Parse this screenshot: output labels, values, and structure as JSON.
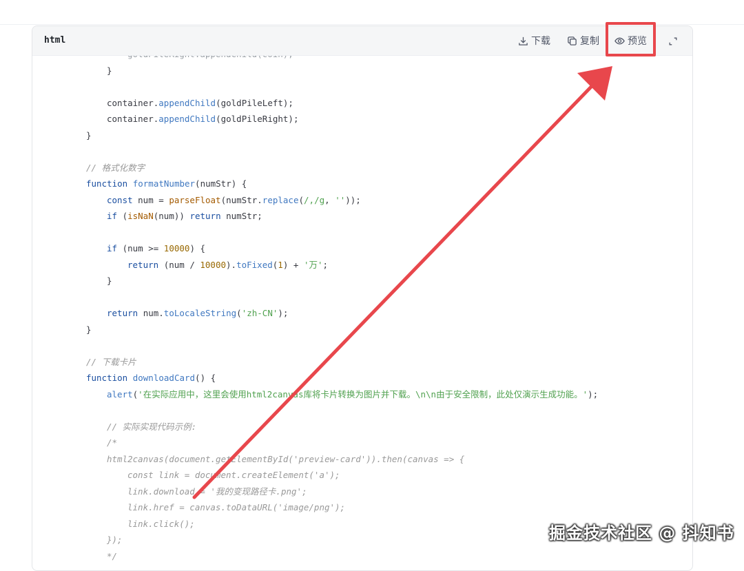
{
  "code_block": {
    "language": "html",
    "toolbar": {
      "download_label": "下载",
      "copy_label": "复制",
      "preview_label": "预览",
      "icons": [
        "download-icon",
        "copy-icon",
        "eye-icon",
        "expand-icon"
      ]
    }
  },
  "code_lines": [
    {
      "indent": 2,
      "parts": [
        [
          "cut",
          "goldPileRight.appendChild(coin);"
        ]
      ]
    },
    {
      "indent": 1,
      "parts": [
        [
          "",
          "}"
        ]
      ]
    },
    {
      "indent": 0,
      "parts": []
    },
    {
      "indent": 1,
      "parts": [
        [
          "",
          "container."
        ],
        [
          "fn",
          "appendChild"
        ],
        [
          "",
          "(goldPileLeft);"
        ]
      ]
    },
    {
      "indent": 1,
      "parts": [
        [
          "",
          "container."
        ],
        [
          "fn",
          "appendChild"
        ],
        [
          "",
          "(goldPileRight);"
        ]
      ]
    },
    {
      "indent": 0,
      "parts": [
        [
          "",
          "}"
        ]
      ]
    },
    {
      "indent": 0,
      "parts": []
    },
    {
      "indent": 0,
      "parts": [
        [
          "cm",
          "// 格式化数字"
        ]
      ]
    },
    {
      "indent": 0,
      "parts": [
        [
          "kw",
          "function "
        ],
        [
          "fn",
          "formatNumber"
        ],
        [
          "",
          "(numStr) {"
        ]
      ]
    },
    {
      "indent": 1,
      "parts": [
        [
          "kw",
          "const "
        ],
        [
          "",
          "num = "
        ],
        [
          "bi",
          "parseFloat"
        ],
        [
          "",
          "(numStr."
        ],
        [
          "fn",
          "replace"
        ],
        [
          "",
          "("
        ],
        [
          "str",
          "/,/g"
        ],
        [
          "",
          ", "
        ],
        [
          "str",
          "''"
        ],
        [
          "",
          "));"
        ]
      ]
    },
    {
      "indent": 1,
      "parts": [
        [
          "kw",
          "if "
        ],
        [
          "",
          "("
        ],
        [
          "bi",
          "isNaN"
        ],
        [
          "",
          "(num)) "
        ],
        [
          "kw",
          "return "
        ],
        [
          "",
          "numStr;"
        ]
      ]
    },
    {
      "indent": 0,
      "parts": []
    },
    {
      "indent": 1,
      "parts": [
        [
          "kw",
          "if "
        ],
        [
          "",
          "(num >= "
        ],
        [
          "num",
          "10000"
        ],
        [
          "",
          ") {"
        ]
      ]
    },
    {
      "indent": 2,
      "parts": [
        [
          "kw",
          "return "
        ],
        [
          "",
          "(num / "
        ],
        [
          "num",
          "10000"
        ],
        [
          "",
          ")."
        ],
        [
          "fn",
          "toFixed"
        ],
        [
          "",
          "("
        ],
        [
          "num",
          "1"
        ],
        [
          "",
          ") + "
        ],
        [
          "str",
          "'万'"
        ],
        [
          "",
          ";"
        ]
      ]
    },
    {
      "indent": 1,
      "parts": [
        [
          "",
          "}"
        ]
      ]
    },
    {
      "indent": 0,
      "parts": []
    },
    {
      "indent": 1,
      "parts": [
        [
          "kw",
          "return "
        ],
        [
          "",
          "num."
        ],
        [
          "fn",
          "toLocaleString"
        ],
        [
          "",
          "("
        ],
        [
          "str",
          "'zh-CN'"
        ],
        [
          "",
          ");"
        ]
      ]
    },
    {
      "indent": 0,
      "parts": [
        [
          "",
          "}"
        ]
      ]
    },
    {
      "indent": 0,
      "parts": []
    },
    {
      "indent": 0,
      "parts": [
        [
          "cm",
          "// 下载卡片"
        ]
      ]
    },
    {
      "indent": 0,
      "parts": [
        [
          "kw",
          "function "
        ],
        [
          "fn",
          "downloadCard"
        ],
        [
          "",
          "() {"
        ]
      ]
    },
    {
      "indent": 1,
      "parts": [
        [
          "fn",
          "alert"
        ],
        [
          "",
          "("
        ],
        [
          "str",
          "'在实际应用中，这里会使用html2canvas库将卡片转换为图片并下载。\\n\\n由于安全限制，此处仅演示生成功能。'"
        ],
        [
          "",
          ");"
        ]
      ]
    },
    {
      "indent": 0,
      "parts": []
    },
    {
      "indent": 1,
      "parts": [
        [
          "cm",
          "// 实际实现代码示例:"
        ]
      ]
    },
    {
      "indent": 1,
      "parts": [
        [
          "cm",
          "/*"
        ]
      ]
    },
    {
      "indent": 1,
      "parts": [
        [
          "cm",
          "html2canvas(document.getElementById('preview-card')).then(canvas => {"
        ]
      ]
    },
    {
      "indent": 2,
      "parts": [
        [
          "cm",
          "const link = document.createElement('a');"
        ]
      ]
    },
    {
      "indent": 2,
      "parts": [
        [
          "cm",
          "link.download = '我的变现路径卡.png';"
        ]
      ]
    },
    {
      "indent": 2,
      "parts": [
        [
          "cm",
          "link.href = canvas.toDataURL('image/png');"
        ]
      ]
    },
    {
      "indent": 2,
      "parts": [
        [
          "cm",
          "link.click();"
        ]
      ]
    },
    {
      "indent": 1,
      "parts": [
        [
          "cm",
          "});"
        ]
      ]
    },
    {
      "indent": 1,
      "parts": [
        [
          "cm",
          "*/"
        ]
      ]
    }
  ],
  "annotation": {
    "arrow_color": "#e8474c",
    "highlight_color": "#e8474c"
  },
  "watermark": {
    "text": "掘金技术社区 @ 抖知书"
  }
}
